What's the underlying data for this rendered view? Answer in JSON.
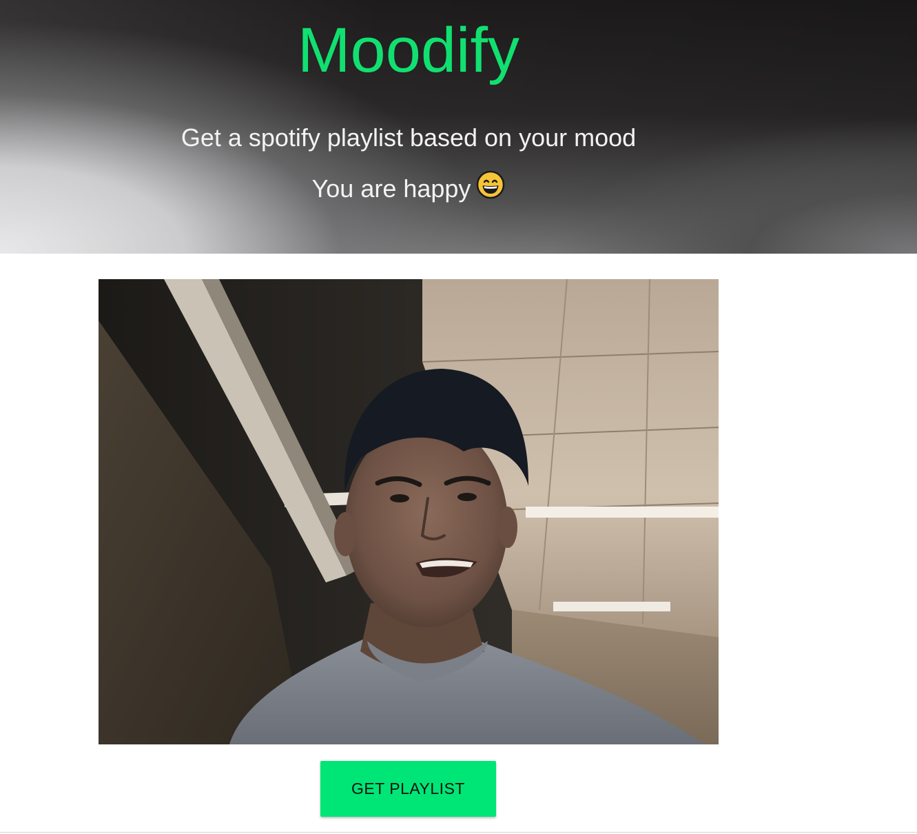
{
  "header": {
    "title": "Moodify",
    "tagline": "Get a spotify playlist based on your mood",
    "mood_text": "You are happy",
    "mood_emoji": "grinning-face-icon"
  },
  "webcam": {
    "subject": "webcam-feed"
  },
  "actions": {
    "get_playlist_label": "GET PLAYLIST"
  },
  "colors": {
    "brand_green": "#11e070",
    "button_green": "#00e676",
    "header_text": "#f3f3f3",
    "emoji_yellow": "#f6c437"
  }
}
